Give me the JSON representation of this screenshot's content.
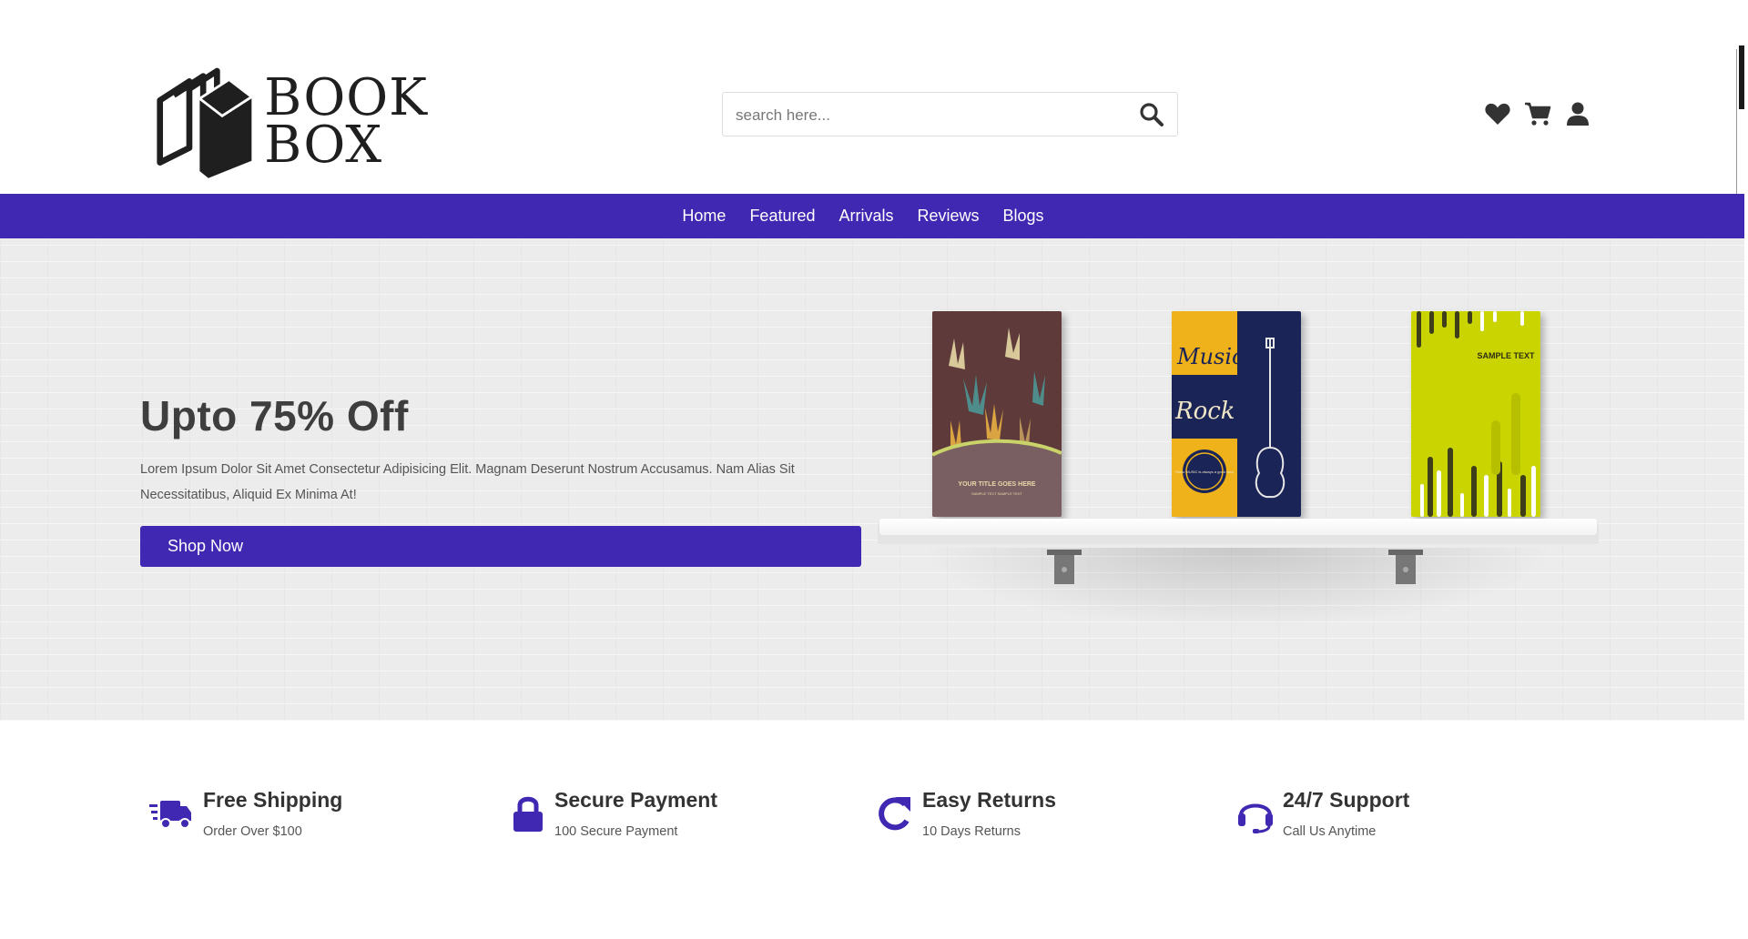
{
  "brand": {
    "logo_line1": "BOOK",
    "logo_line2": "BOX",
    "logo_icon": "book-stack-icon"
  },
  "search": {
    "placeholder": "search here...",
    "value": "",
    "icon": "search-icon"
  },
  "header_icons": [
    "heart-icon",
    "cart-icon",
    "user-icon"
  ],
  "nav": {
    "items": [
      "Home",
      "Featured",
      "Arrivals",
      "Reviews",
      "Blogs"
    ]
  },
  "hero": {
    "title": "Upto 75% Off",
    "text": "Lorem Ipsum Dolor Sit Amet Consectetur Adipisicing Elit. Magnam Deserunt Nostrum Accusamus. Nam Alias Sit Necessitatibus, Aliquid Ex Minima At!",
    "button_label": "Shop Now",
    "books": [
      {
        "cover_text": "YOUR TITLE GOES HERE",
        "cover_subtext": "SAMPLE TEXT SAMPLE TEXT"
      },
      {
        "cover_text_1": "Music",
        "cover_text_2": "Rock",
        "cover_badge": "Relax MUSIC is always a good idea"
      },
      {
        "cover_text": "SAMPLE TEXT"
      }
    ]
  },
  "features": [
    {
      "icon": "truck-icon",
      "title": "Free Shipping",
      "subtitle": "Order Over $100"
    },
    {
      "icon": "lock-icon",
      "title": "Secure Payment",
      "subtitle": "100 Secure Payment"
    },
    {
      "icon": "redo-icon",
      "title": "Easy Returns",
      "subtitle": "10 Days Returns"
    },
    {
      "icon": "headset-icon",
      "title": "24/7 Support",
      "subtitle": "Call Us Anytime"
    }
  ],
  "colors": {
    "accent": "#4128b2",
    "text_dark": "#333333",
    "hero_bg": "#ececec"
  }
}
